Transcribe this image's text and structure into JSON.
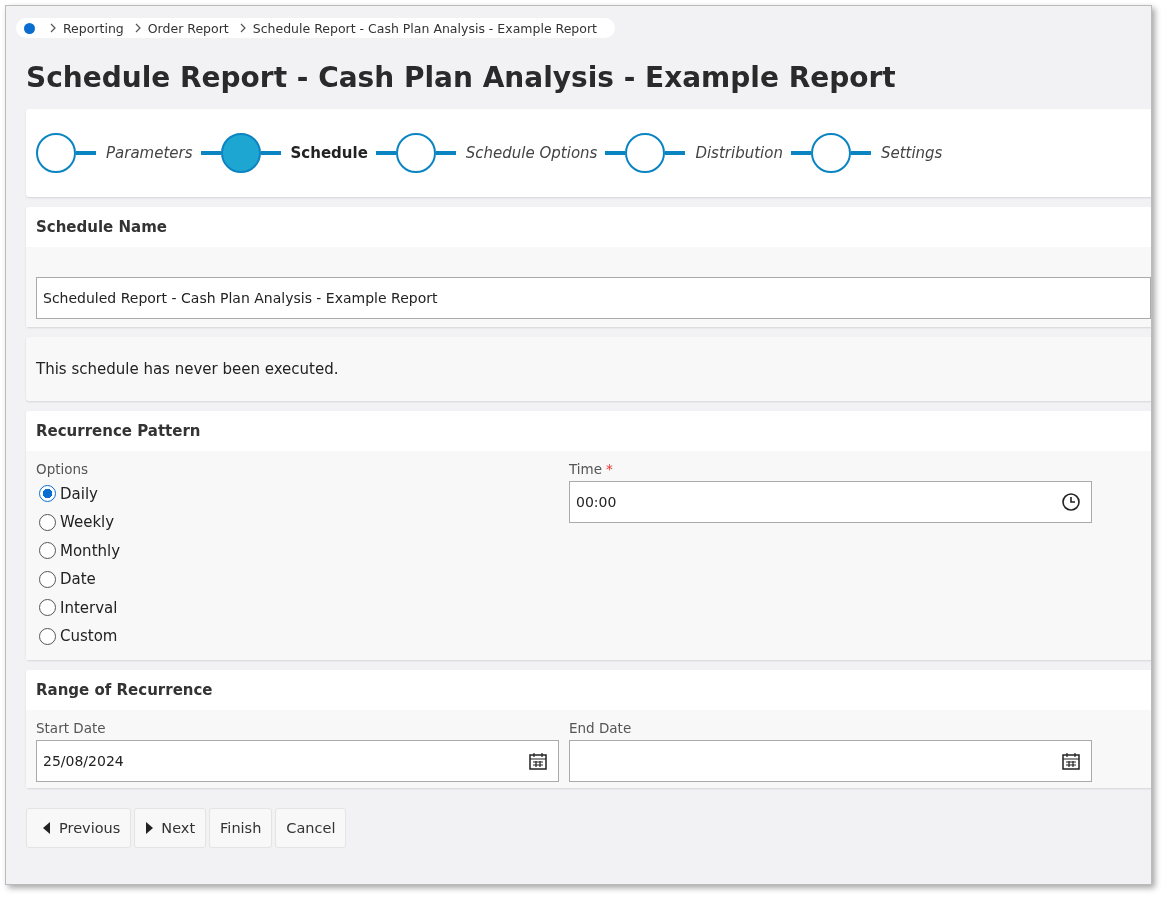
{
  "breadcrumb": {
    "items": [
      {
        "label": "Reporting"
      },
      {
        "label": "Order Report"
      },
      {
        "label": "Schedule Report - Cash Plan Analysis - Example Report"
      }
    ]
  },
  "title": "Schedule Report - Cash Plan Analysis - Example Report",
  "steps": [
    {
      "label": "Parameters",
      "selected": false
    },
    {
      "label": "Schedule",
      "selected": true
    },
    {
      "label": "Schedule Options",
      "selected": false
    },
    {
      "label": "Distribution",
      "selected": false
    },
    {
      "label": "Settings",
      "selected": false
    }
  ],
  "schedule_name": {
    "heading": "Schedule Name",
    "value": "Scheduled Report - Cash Plan Analysis - Example Report"
  },
  "info": "This schedule has never been executed.",
  "recurrence": {
    "heading": "Recurrence Pattern",
    "options_label": "Options",
    "options": [
      {
        "label": "Daily",
        "selected": true
      },
      {
        "label": "Weekly",
        "selected": false
      },
      {
        "label": "Monthly",
        "selected": false
      },
      {
        "label": "Date",
        "selected": false
      },
      {
        "label": "Interval",
        "selected": false
      },
      {
        "label": "Custom",
        "selected": false
      }
    ],
    "time": {
      "label": "Time",
      "required_mark": "*",
      "value": "00:00"
    }
  },
  "range": {
    "heading": "Range of Recurrence",
    "start": {
      "label": "Start Date",
      "value": "25/08/2024"
    },
    "end": {
      "label": "End Date"
    }
  },
  "buttons": [
    {
      "label": "Previous",
      "kind": "prev"
    },
    {
      "label": "Next",
      "kind": "next"
    },
    {
      "label": "Finish",
      "kind": "plain"
    },
    {
      "label": "Cancel",
      "kind": "plain"
    }
  ]
}
